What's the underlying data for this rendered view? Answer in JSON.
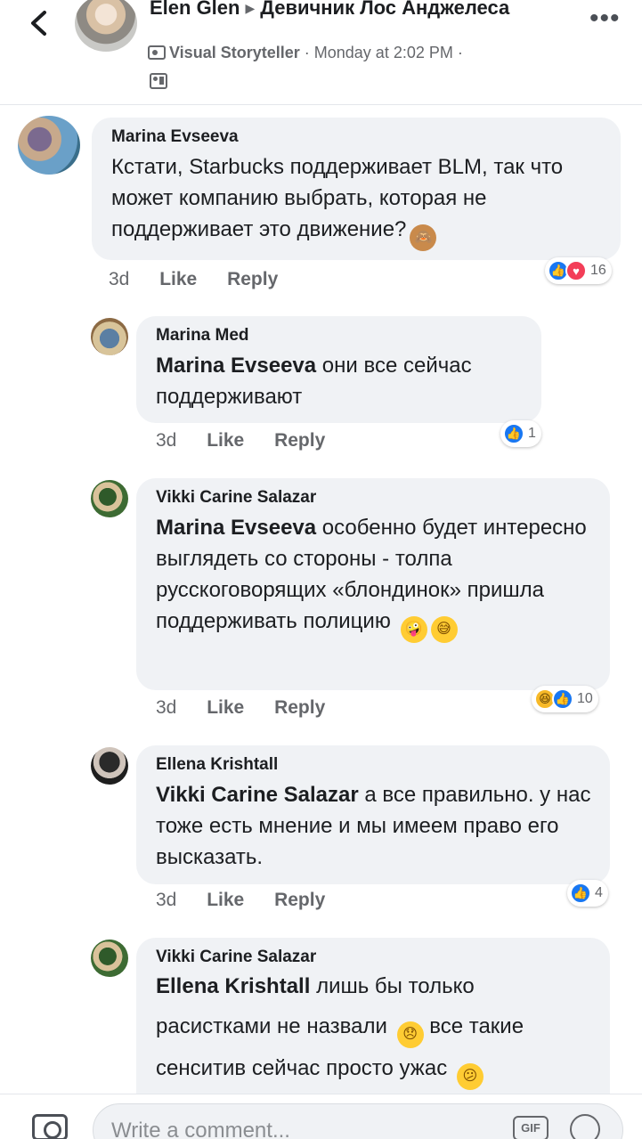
{
  "header": {
    "author": "Elen Glen",
    "group": "Девичник Лос Анджелеса",
    "badge": "Visual Storyteller",
    "time": "Monday at 2:02 PM",
    "separator": "·"
  },
  "comments": [
    {
      "author": "Marina Evseeva",
      "mention": "",
      "text": "Кстати, Starbucks поддерживает BLM, так что может компанию выбрать, которая не поддерживает это движение?",
      "emoji": [
        "see-no-evil-monkey"
      ],
      "time": "3d",
      "like": "Like",
      "reply": "Reply",
      "reaction_count": "16"
    },
    {
      "author": "Marina Med",
      "mention": "Marina Evseeva",
      "text": "они все сейчас поддерживают",
      "time": "3d",
      "like": "Like",
      "reply": "Reply",
      "reaction_count": "1"
    },
    {
      "author": "Vikki Carine Salazar",
      "mention": "Marina Evseeva",
      "text": "особенно будет интересно выглядеть со стороны - толпа русскоговорящих «блондинок» пришла поддерживать полицию",
      "emoji": [
        "zany-face",
        "grinning-sweat"
      ],
      "time": "3d",
      "like": "Like",
      "reply": "Reply",
      "reaction_count": "10"
    },
    {
      "author": "Ellena Krishtall",
      "mention": "Vikki Carine Salazar",
      "text": "а все правильно. у нас тоже есть мнение и мы имеем право его высказать.",
      "time": "3d",
      "like": "Like",
      "reply": "Reply",
      "reaction_count": "4"
    },
    {
      "author": "Vikki Carine Salazar",
      "mention": "Ellena Krishtall",
      "text1": "лишь бы только расистками не назвали",
      "text2": "все такие сенситив сейчас просто ужас",
      "emoji": [
        "disappointed-face",
        "confused-face"
      ]
    }
  ],
  "composer": {
    "placeholder": "Write a comment...",
    "gif": "GIF"
  },
  "colors": {
    "accent": "#1877f2",
    "bubble": "#f0f2f5",
    "meta": "#65676b"
  }
}
